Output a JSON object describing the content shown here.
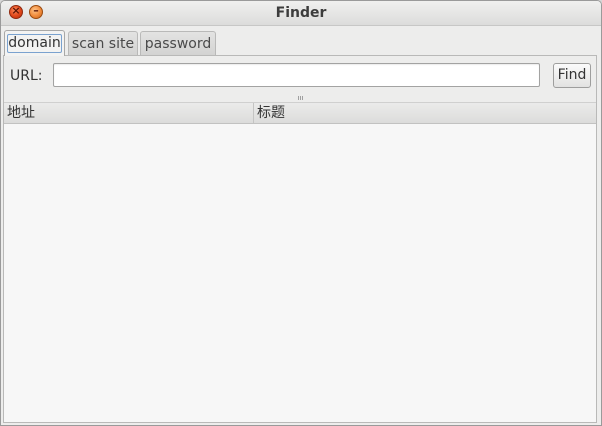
{
  "window": {
    "title": "Finder",
    "controls": [
      "close",
      "minimize"
    ]
  },
  "tabs": [
    {
      "label": "domain",
      "active": true
    },
    {
      "label": "scan site",
      "active": false
    },
    {
      "label": "password",
      "active": false
    }
  ],
  "form": {
    "url_label": "URL:",
    "url_value": "",
    "find_label": "Find"
  },
  "table": {
    "columns": [
      "地址",
      "标题"
    ],
    "rows": []
  },
  "icons": {
    "close": "close-icon",
    "minimize": "minimize-icon"
  },
  "colors": {
    "close": "#e0461a",
    "minimize": "#f08a3a",
    "focus_ring": "#7aa2cf"
  }
}
